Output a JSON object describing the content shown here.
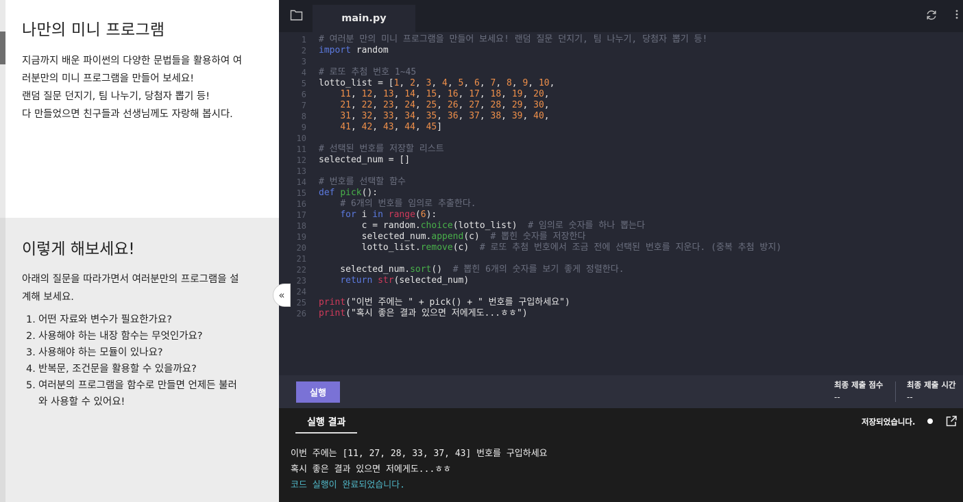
{
  "description": {
    "title": "나만의 미니 프로그램",
    "lines": [
      "지금까지 배운 파이썬의 다양한 문법들을 활용하여 여",
      "러분만의 미니 프로그램을 만들어 보세요!",
      "랜덤 질문 던지기, 팀 나누기, 당첨자 뽑기 등!",
      "다 만들었으면 친구들과 선생님께도 자랑해 봅시다."
    ]
  },
  "guide": {
    "title": "이렇게 해보세요!",
    "intro_lines": [
      "아래의 질문을 따라가면서 여러분만의 프로그램을 설",
      "계해 보세요."
    ],
    "items": [
      {
        "num": "1.",
        "lines": [
          "어떤 자료와 변수가 필요한가요?"
        ]
      },
      {
        "num": "2.",
        "lines": [
          "사용해야 하는 내장 함수는 무엇인가요?"
        ]
      },
      {
        "num": "3.",
        "lines": [
          "사용해야 하는 모듈이 있나요?"
        ]
      },
      {
        "num": "4.",
        "lines": [
          "반복문, 조건문을 활용할 수 있을까요?"
        ]
      },
      {
        "num": "5.",
        "lines": [
          "여러분의 프로그램을 함수로 만들면 언제든 불러",
          "와 사용할 수 있어요!"
        ]
      }
    ]
  },
  "collapse_label": "«",
  "editor": {
    "tab_label": "main.py",
    "icons": {
      "folder": "folder-icon",
      "refresh": "refresh-icon",
      "more": "more-icon"
    },
    "code_lines": [
      {
        "n": "1",
        "text": "# 여러분 만의 미니 프로그램을 만들어 보세요! 랜덤 질문 던지기, 팀 나누기, 당첨자 뽑기 등!"
      },
      {
        "n": "2",
        "text": "import random"
      },
      {
        "n": "3",
        "text": ""
      },
      {
        "n": "4",
        "text": "# 로또 추첨 번호 1~45"
      },
      {
        "n": "5",
        "text": "lotto_list = [1, 2, 3, 4, 5, 6, 7, 8, 9, 10,"
      },
      {
        "n": "6",
        "text": "    11, 12, 13, 14, 15, 16, 17, 18, 19, 20,"
      },
      {
        "n": "7",
        "text": "    21, 22, 23, 24, 25, 26, 27, 28, 29, 30,"
      },
      {
        "n": "8",
        "text": "    31, 32, 33, 34, 35, 36, 37, 38, 39, 40,"
      },
      {
        "n": "9",
        "text": "    41, 42, 43, 44, 45]"
      },
      {
        "n": "10",
        "text": ""
      },
      {
        "n": "11",
        "text": "# 선택된 번호를 저장할 리스트"
      },
      {
        "n": "12",
        "text": "selected_num = []"
      },
      {
        "n": "13",
        "text": ""
      },
      {
        "n": "14",
        "text": "# 번호를 선택할 함수"
      },
      {
        "n": "15",
        "text": "def pick():"
      },
      {
        "n": "16",
        "text": "    # 6개의 번호를 임의로 추출한다."
      },
      {
        "n": "17",
        "text": "    for i in range(6):"
      },
      {
        "n": "18",
        "text": "        c = random.choice(lotto_list)  # 임의로 숫자를 하나 뽑는다"
      },
      {
        "n": "19",
        "text": "        selected_num.append(c)  # 뽑힌 숫자를 저장한다"
      },
      {
        "n": "20",
        "text": "        lotto_list.remove(c)  # 로또 추첨 번호에서 조금 전에 선택된 번호를 지운다. (중복 추첨 방지)"
      },
      {
        "n": "21",
        "text": "    "
      },
      {
        "n": "22",
        "text": "    selected_num.sort()  # 뽑힌 6개의 숫자를 보기 좋게 정렬한다."
      },
      {
        "n": "23",
        "text": "    return str(selected_num)"
      },
      {
        "n": "24",
        "text": ""
      },
      {
        "n": "25",
        "text": "print(\"이번 주에는 \" + pick() + \" 번호를 구입하세요\")"
      },
      {
        "n": "26",
        "text": "print(\"혹시 좋은 결과 있으면 저에게도...ㅎㅎ\")"
      }
    ]
  },
  "runbar": {
    "run_label": "실행",
    "final_score_label": "최종 제출 점수",
    "final_score_value": "--",
    "final_time_label": "최종 제출 시간",
    "final_time_value": "--"
  },
  "result": {
    "tab_label": "실행 결과",
    "saved_text": "저장되었습니다.",
    "output_lines": [
      "이번 주에는 [11, 27, 28, 33, 37, 43] 번호를 구입하세요",
      "혹시 좋은 결과 있으면 저에게도...ㅎㅎ"
    ],
    "done_text": "코드 실행이 완료되었습니다."
  },
  "colors": {
    "accent": "#7a72d6",
    "editor_bg": "#262833",
    "comment": "#6c7080",
    "keyword": "#5c7ae0",
    "number": "#f0904a",
    "method": "#49b24a",
    "builtin": "#d03a5a",
    "done": "#4fb5c5"
  }
}
